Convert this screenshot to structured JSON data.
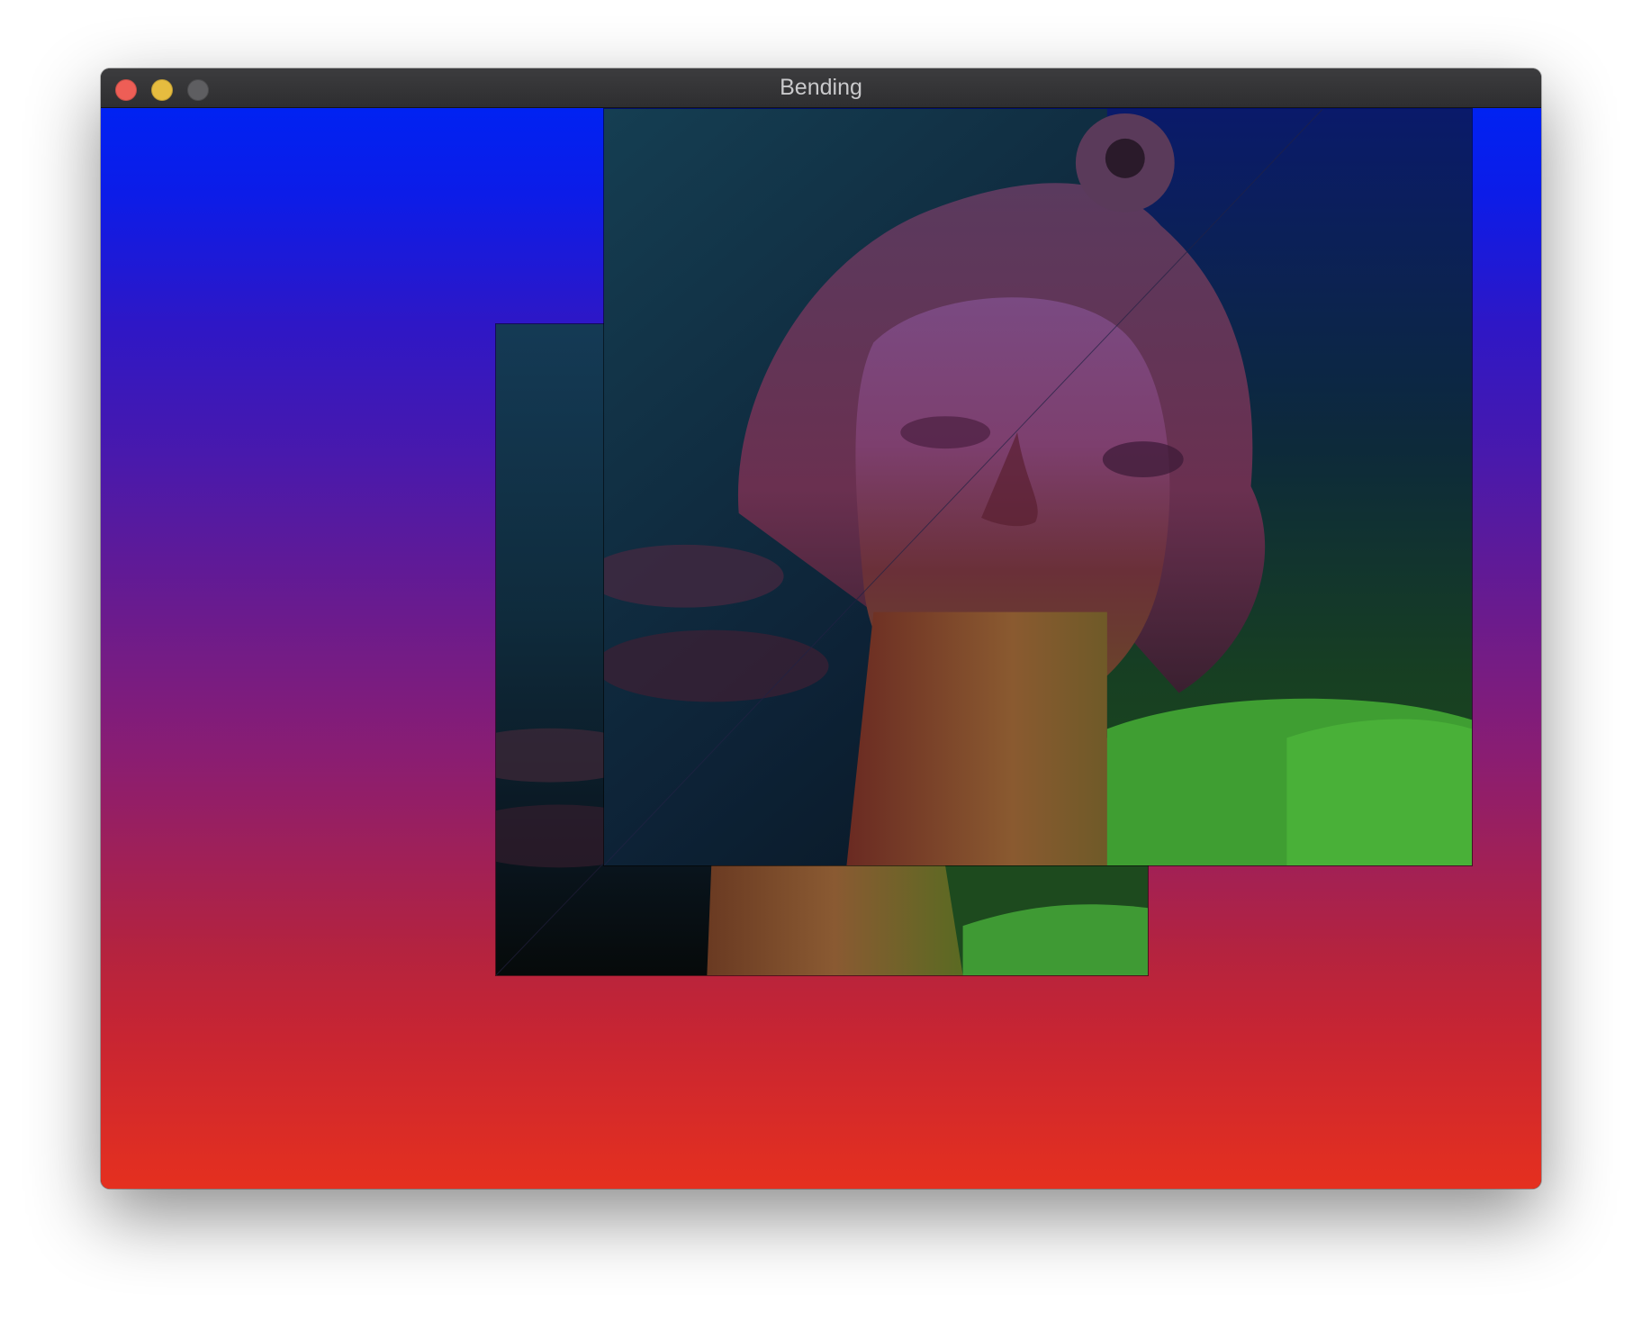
{
  "window": {
    "title": "Bending"
  },
  "colors": {
    "gradient_top": "#0022f2",
    "gradient_bottom": "#e5301f",
    "close": "#ee5e56",
    "minimize": "#e6bc3f",
    "zoom": "#5e5e61"
  },
  "icons": {
    "close": "close-traffic-light",
    "minimize": "minimize-traffic-light",
    "zoom": "zoom-traffic-light"
  }
}
